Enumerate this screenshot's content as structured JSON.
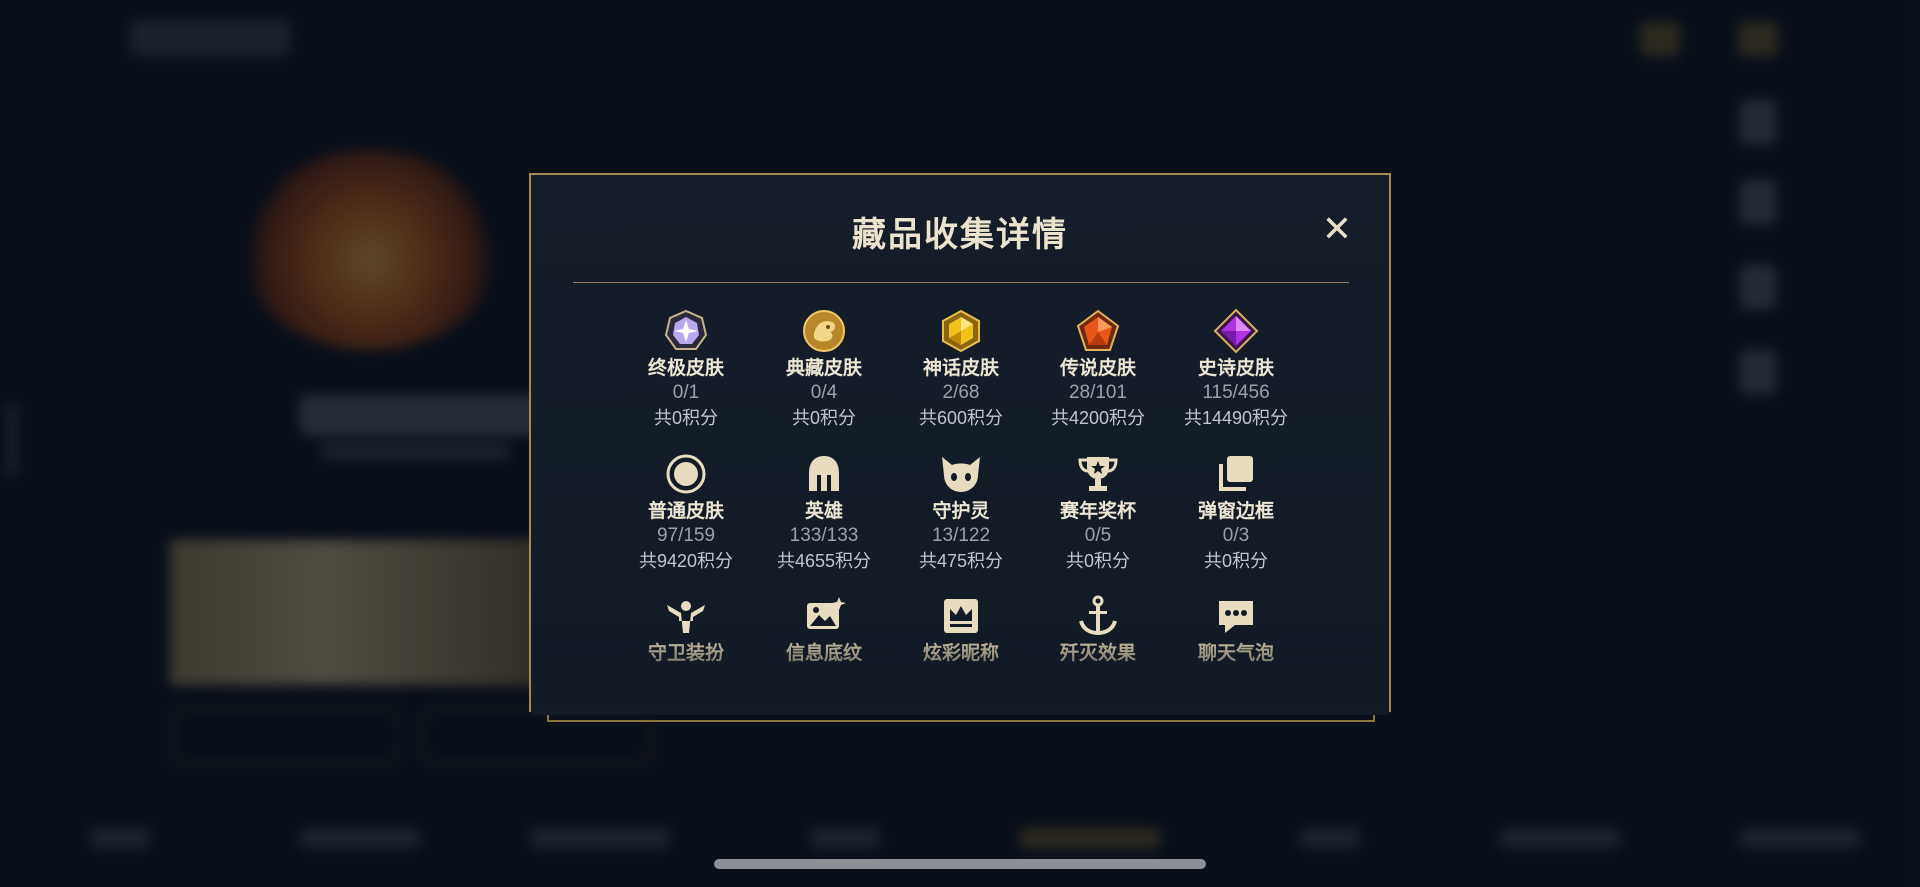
{
  "dialog": {
    "title": "藏品收集详情",
    "close_glyph": "✕"
  },
  "items": [
    {
      "id": "ultimate",
      "icon": "ultimate-skin-icon",
      "label": "终极皮肤",
      "count": "0/1",
      "points": "共0积分"
    },
    {
      "id": "collector",
      "icon": "collector-skin-icon",
      "label": "典藏皮肤",
      "count": "0/4",
      "points": "共0积分"
    },
    {
      "id": "mythic",
      "icon": "mythic-skin-icon",
      "label": "神话皮肤",
      "count": "2/68",
      "points": "共600积分"
    },
    {
      "id": "legendary",
      "icon": "legendary-skin-icon",
      "label": "传说皮肤",
      "count": "28/101",
      "points": "共4200积分"
    },
    {
      "id": "epic",
      "icon": "epic-skin-icon",
      "label": "史诗皮肤",
      "count": "115/456",
      "points": "共14490积分"
    },
    {
      "id": "normal",
      "icon": "normal-skin-icon",
      "label": "普通皮肤",
      "count": "97/159",
      "points": "共9420积分"
    },
    {
      "id": "hero",
      "icon": "hero-helmet-icon",
      "label": "英雄",
      "count": "133/133",
      "points": "共4655积分"
    },
    {
      "id": "guardian",
      "icon": "guardian-spirit-icon",
      "label": "守护灵",
      "count": "13/122",
      "points": "共475积分"
    },
    {
      "id": "trophy",
      "icon": "trophy-icon",
      "label": "赛年奖杯",
      "count": "0/5",
      "points": "共0积分"
    },
    {
      "id": "frame",
      "icon": "popup-frame-icon",
      "label": "弹窗边框",
      "count": "0/3",
      "points": "共0积分"
    },
    {
      "id": "ward",
      "icon": "ward-skin-icon",
      "label": "守卫装扮",
      "count": "",
      "points": ""
    },
    {
      "id": "banner",
      "icon": "info-banner-icon",
      "label": "信息底纹",
      "count": "",
      "points": ""
    },
    {
      "id": "nickname",
      "icon": "nickname-crown-icon",
      "label": "炫彩昵称",
      "count": "",
      "points": ""
    },
    {
      "id": "kill",
      "icon": "kill-effect-icon",
      "label": "歼灭效果",
      "count": "",
      "points": ""
    },
    {
      "id": "chat",
      "icon": "chat-bubble-icon",
      "label": "聊天气泡",
      "count": "",
      "points": ""
    }
  ],
  "colors": {
    "gold_border": "#a68b55",
    "title_text": "#ece3cf",
    "count_text": "#9aa2ad"
  }
}
